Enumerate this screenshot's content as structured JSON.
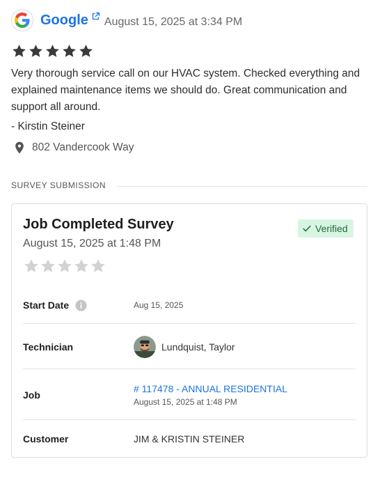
{
  "review": {
    "source": "Google",
    "date": "August 15, 2025 at 3:34 PM",
    "rating": 5,
    "text": "Very thorough service call on our HVAC system. Checked everything and explained maintenance items we should do. Great communication and support all around.",
    "author": "- Kirstin Steiner",
    "address": "802 Vandercook Way"
  },
  "section": {
    "label": "SURVEY SUBMISSION"
  },
  "survey": {
    "title": "Job Completed Survey",
    "date": "August 15, 2025 at 1:48 PM",
    "rating": 0,
    "verified_label": "Verified",
    "start_date_label": "Start Date",
    "start_date_value": "Aug 15, 2025",
    "technician_label": "Technician",
    "technician_value": "Lundquist, Taylor",
    "job_label": "Job",
    "job_link": "# 117478 - ANNUAL RESIDENTIAL",
    "job_date": "August 15, 2025 at 1:48 PM",
    "customer_label": "Customer",
    "customer_value": "JIM & KRISTIN STEINER"
  },
  "icons": {
    "google_logo": "google-logo-icon",
    "external_link": "external-link-icon",
    "star": "star-icon",
    "pin": "map-pin-icon",
    "check": "check-icon",
    "info": "info-icon",
    "avatar": "technician-avatar"
  },
  "colors": {
    "link": "#1a73e8",
    "star_filled": "#3a3a3a",
    "star_empty": "#d2d2d2",
    "verified_bg": "#d8f5e3",
    "verified_text": "#1e6b3b"
  }
}
